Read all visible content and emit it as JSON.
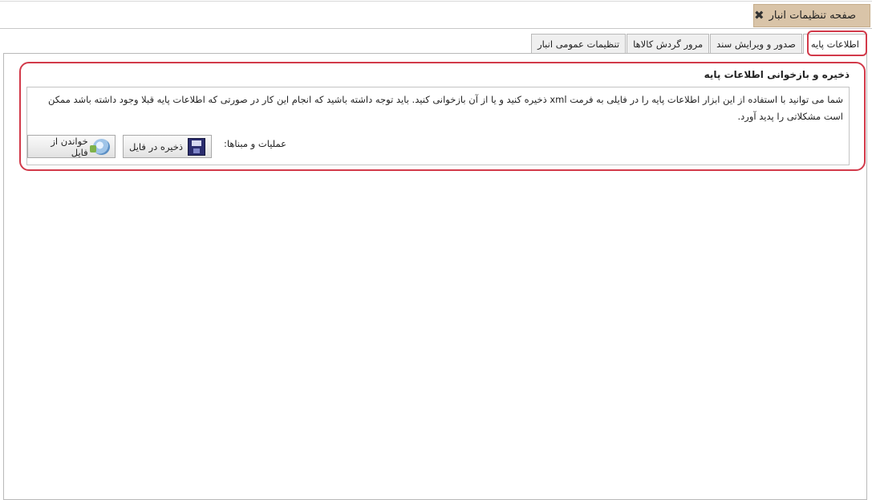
{
  "page_tab": {
    "title": "صفحه تنظیمات انبار",
    "close_icon": "close-icon"
  },
  "tabs": [
    {
      "label": "اطلاعات پایه",
      "active": true
    },
    {
      "label": "صدور و ویرایش سند",
      "active": false
    },
    {
      "label": "مرور گردش کالاها",
      "active": false
    },
    {
      "label": "تنظیمات عمومی انبار",
      "active": false
    }
  ],
  "section": {
    "title": "ذخیره و بازخوانی اطلاعات پایه",
    "description": "شما می توانید با استفاده از این ابزار اطلاعات پایه را در فایلی به فرمت xml ذخیره کنید و یا از آن بازخوانی کنید. باید توجه داشته باشید که انجام این کار در صورتی که اطلاعات پایه قبلا وجود داشته باشد ممکن است مشکلاتی را پدید آورد.",
    "operations_label": "عملیات و مبناها:",
    "save_button": "ذخیره در فایل",
    "read_button": "خواندن از فایل"
  },
  "colors": {
    "page_tab_bg": "#d9c4a8",
    "highlight": "#d23a4a"
  }
}
